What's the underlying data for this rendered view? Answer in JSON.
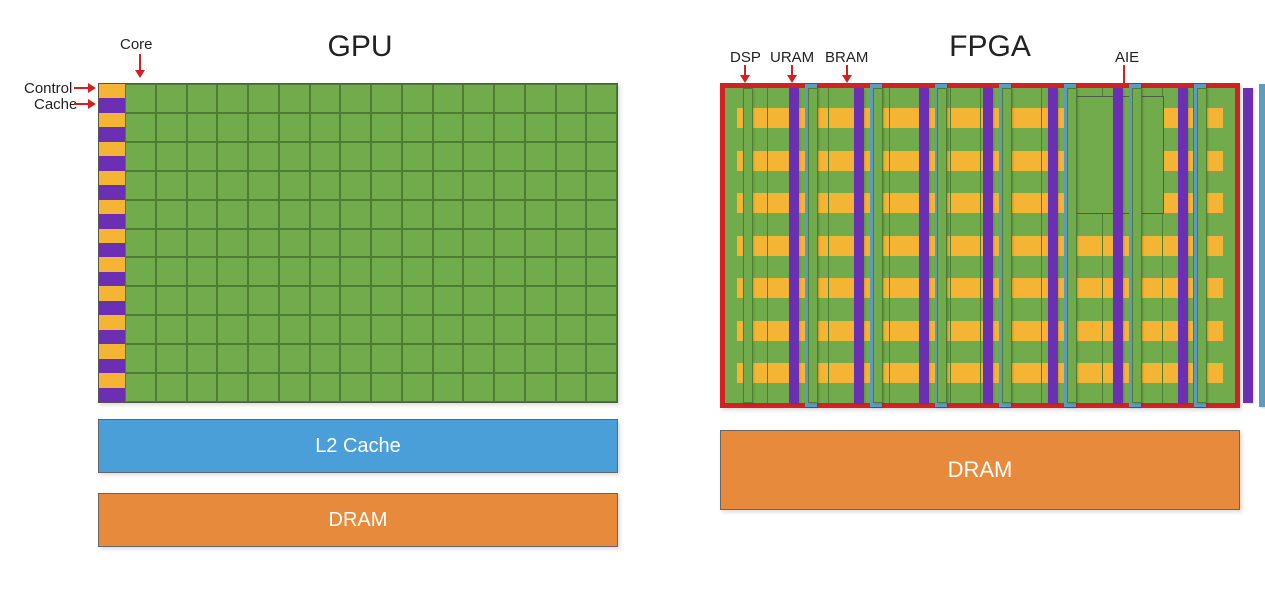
{
  "gpu": {
    "title": "GPU",
    "labels": {
      "core": "Core",
      "control": "Control",
      "cache": "Cache",
      "l2": "L2 Cache",
      "dram": "DRAM"
    },
    "grid": {
      "cols": 16,
      "rows": 11
    },
    "side_stripes": 11
  },
  "fpga": {
    "title": "FPGA",
    "labels": {
      "dsp": "DSP",
      "uram": "URAM",
      "bram": "BRAM",
      "aie": "AIE",
      "dram": "DRAM"
    },
    "horizontal_rows": 7,
    "vertical_groups": 8,
    "stripes_per_group": [
      "dsp",
      "uram",
      "bram"
    ],
    "clb_cols": 16,
    "aie_block": {
      "col_start": 11,
      "col_end": 14,
      "row_start": 0,
      "row_end": 3
    }
  }
}
